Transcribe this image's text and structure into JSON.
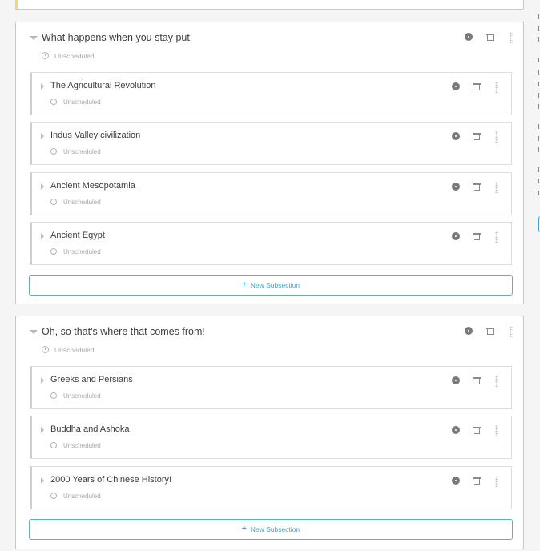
{
  "sections": [
    {
      "title": "What happens when you stay put",
      "status": "Unscheduled",
      "subsections": [
        {
          "title": "The Agricultural Revolution",
          "status": "Unscheduled"
        },
        {
          "title": "Indus Valley civilization",
          "status": "Unscheduled"
        },
        {
          "title": "Ancient Mesopotamia",
          "status": "Unscheduled"
        },
        {
          "title": "Ancient Egypt",
          "status": "Unscheduled"
        }
      ],
      "new_subsection_label": "New Subsection"
    },
    {
      "title": "Oh, so that's where that comes from!",
      "status": "Unscheduled",
      "subsections": [
        {
          "title": "Greeks and Persians",
          "status": "Unscheduled"
        },
        {
          "title": "Buddha and Ashoka",
          "status": "Unscheduled"
        },
        {
          "title": "2000 Years of Chinese History!",
          "status": "Unscheduled"
        }
      ],
      "new_subsection_label": "New Subsection"
    }
  ],
  "icons": {
    "collapse": "caret-down-icon",
    "expand": "caret-right-icon",
    "settings": "gear-icon",
    "delete": "trash-icon",
    "reorder": "drag-handle-icon",
    "status": "clock-icon",
    "add": "plus-icon"
  },
  "colors": {
    "accent": "#3ba6cf",
    "warning_edge": "#f4d66a"
  }
}
